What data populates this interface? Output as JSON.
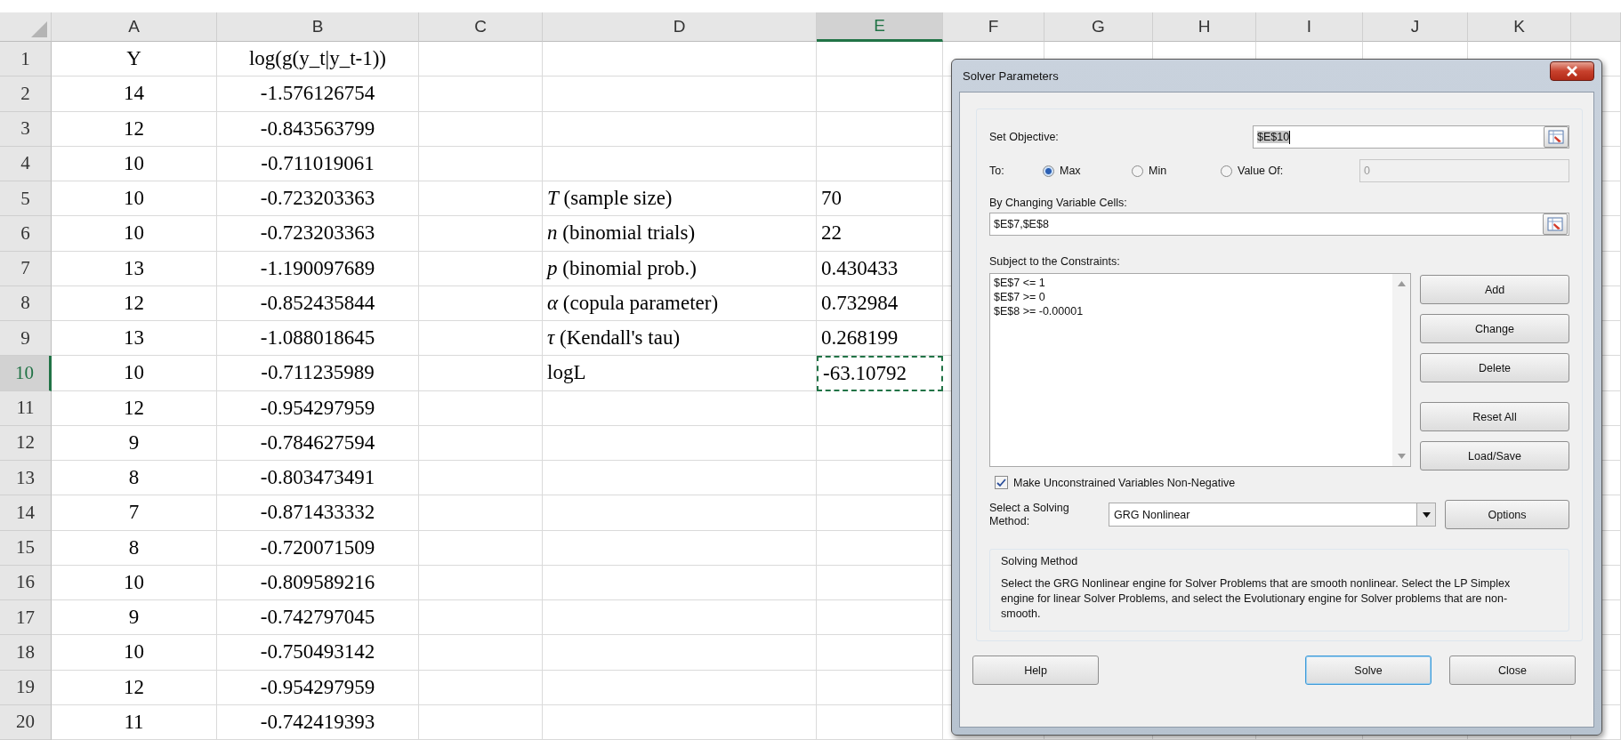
{
  "sheet": {
    "columns": [
      {
        "label": "A",
        "selected": false
      },
      {
        "label": "B",
        "selected": false
      },
      {
        "label": "C",
        "selected": false
      },
      {
        "label": "D",
        "selected": false
      },
      {
        "label": "E",
        "selected": true
      },
      {
        "label": "F",
        "selected": false
      },
      {
        "label": "G",
        "selected": false
      },
      {
        "label": "H",
        "selected": false
      },
      {
        "label": "I",
        "selected": false
      },
      {
        "label": "J",
        "selected": false
      },
      {
        "label": "K",
        "selected": false
      }
    ],
    "rows": [
      {
        "number": "1",
        "selected": false,
        "cells": {
          "a": "Y",
          "b": "log(g(y_t|y_t-1))"
        }
      },
      {
        "number": "2",
        "selected": false,
        "cells": {
          "a": "14",
          "b": "-1.576126754"
        }
      },
      {
        "number": "3",
        "selected": false,
        "cells": {
          "a": "12",
          "b": "-0.843563799"
        }
      },
      {
        "number": "4",
        "selected": false,
        "cells": {
          "a": "10",
          "b": "-0.711019061"
        }
      },
      {
        "number": "5",
        "selected": false,
        "cells": {
          "a": "10",
          "b": "-0.723203363",
          "d": "*T* (sample size)",
          "e": "70"
        }
      },
      {
        "number": "6",
        "selected": false,
        "cells": {
          "a": "10",
          "b": "-0.723203363",
          "d": "*n* (binomial trials)",
          "e": "22"
        }
      },
      {
        "number": "7",
        "selected": false,
        "cells": {
          "a": "13",
          "b": "-1.190097689",
          "d": "*p* (binomial prob.)",
          "e": "0.430433"
        }
      },
      {
        "number": "8",
        "selected": false,
        "cells": {
          "a": "12",
          "b": "-0.852435844",
          "d": "*α* (copula parameter)",
          "e": "0.732984"
        }
      },
      {
        "number": "9",
        "selected": false,
        "cells": {
          "a": "13",
          "b": "-1.088018645",
          "d": "*τ* (Kendall's tau)",
          "e": "0.268199"
        }
      },
      {
        "number": "10",
        "selected": true,
        "cells": {
          "a": "10",
          "b": "-0.711235989",
          "d": "logL",
          "e": "-63.10792"
        },
        "marquee": true
      },
      {
        "number": "11",
        "selected": false,
        "cells": {
          "a": "12",
          "b": "-0.954297959"
        }
      },
      {
        "number": "12",
        "selected": false,
        "cells": {
          "a": "9",
          "b": "-0.784627594"
        }
      },
      {
        "number": "13",
        "selected": false,
        "cells": {
          "a": "8",
          "b": "-0.803473491"
        }
      },
      {
        "number": "14",
        "selected": false,
        "cells": {
          "a": "7",
          "b": "-0.871433332"
        }
      },
      {
        "number": "15",
        "selected": false,
        "cells": {
          "a": "8",
          "b": "-0.720071509"
        }
      },
      {
        "number": "16",
        "selected": false,
        "cells": {
          "a": "10",
          "b": "-0.809589216"
        }
      },
      {
        "number": "17",
        "selected": false,
        "cells": {
          "a": "9",
          "b": "-0.742797045"
        }
      },
      {
        "number": "18",
        "selected": false,
        "cells": {
          "a": "10",
          "b": "-0.750493142"
        }
      },
      {
        "number": "19",
        "selected": false,
        "cells": {
          "a": "12",
          "b": "-0.954297959"
        }
      },
      {
        "number": "20",
        "selected": false,
        "cells": {
          "a": "11",
          "b": "-0.742419393"
        }
      }
    ]
  },
  "dialog": {
    "title": "Solver Parameters",
    "objective": {
      "label": "Set Objective:",
      "value": "$E$10"
    },
    "to": {
      "label": "To:",
      "options": [
        {
          "label": "Max",
          "selected": true
        },
        {
          "label": "Min",
          "selected": false
        },
        {
          "label": "Value Of:",
          "selected": false
        }
      ],
      "value_of": {
        "value": "0",
        "disabled": true
      }
    },
    "changing": {
      "label": "By Changing Variable Cells:",
      "value": "$E$7,$E$8"
    },
    "constraints": {
      "label": "Subject to the Constraints:",
      "items": [
        "$E$7 <= 1",
        "$E$7 >= 0",
        "$E$8 >= -0.00001"
      ]
    },
    "side_buttons": [
      "Add",
      "Change",
      "Delete",
      "Reset All",
      "Load/Save"
    ],
    "nonneg": {
      "label": "Make Unconstrained Variables Non-Negative",
      "checked": true
    },
    "method": {
      "label": "Select a Solving Method:",
      "value": "GRG Nonlinear",
      "button": "Options"
    },
    "description": {
      "title": "Solving Method",
      "text": "Select the GRG Nonlinear engine for Solver Problems that are smooth nonlinear. Select the LP Simplex engine for linear Solver Problems, and select the Evolutionary engine for Solver problems that are non-smooth."
    },
    "footer": [
      {
        "label": "Help",
        "default": false
      },
      {
        "label": "Solve",
        "default": true
      },
      {
        "label": "Close",
        "default": false
      }
    ]
  }
}
